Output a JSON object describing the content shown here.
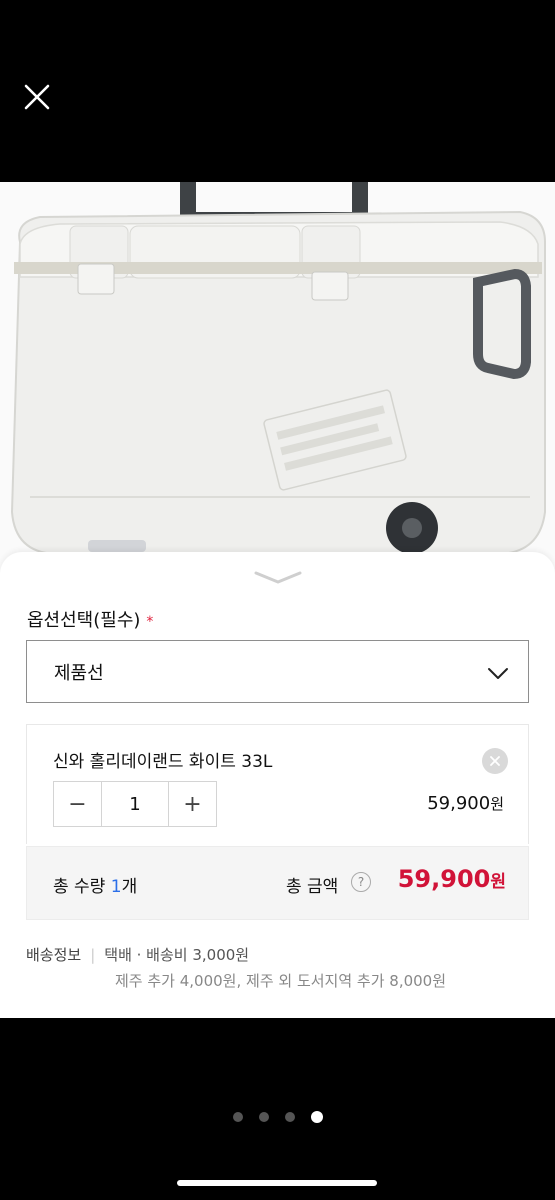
{
  "viewer": {
    "close_icon": "close-icon",
    "hero_icon": "product-image"
  },
  "option": {
    "title": "옵션선택(필수)",
    "required_mark": "*"
  },
  "select": {
    "value": "제품선"
  },
  "item": {
    "name": "신와 홀리데이랜드 화이트 33L",
    "quantity": "1",
    "price": "59,900",
    "currency": "원",
    "minus": "−",
    "plus": "+"
  },
  "summary": {
    "qty_label": "총 수량",
    "qty_value": "1",
    "qty_unit": "개",
    "amount_label": "총 금액",
    "help": "?",
    "amount": "59,900",
    "currency": "원"
  },
  "shipping": {
    "label": "배송정보",
    "method": "택배 · 배송비 3,000원",
    "extra": "제주 추가 4,000원, 제주 외 도서지역 추가 8,000원"
  },
  "pagination": {
    "total": 4,
    "active_index": 3
  },
  "colors": {
    "accent_red": "#d11338",
    "qty_blue": "#2c6fe8",
    "required_red": "#e0203c"
  }
}
